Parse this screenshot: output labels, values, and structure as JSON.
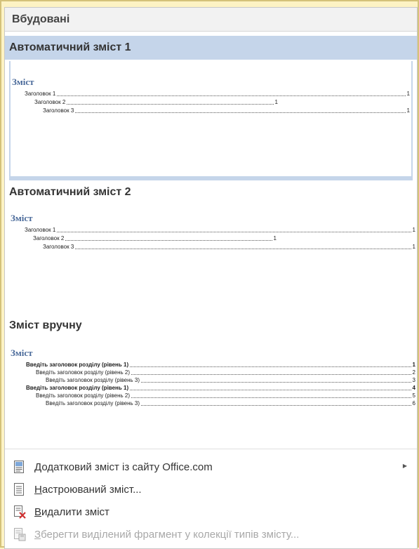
{
  "header": {
    "section_label": "Вбудовані"
  },
  "items": [
    {
      "title": "Автоматичний зміст 1",
      "toc_word": "Зміст",
      "entries": [
        {
          "label": "Заголовок 1",
          "page": "1"
        },
        {
          "label": "Заголовок 2",
          "page": "1"
        },
        {
          "label": "Заголовок 3",
          "page": "1"
        }
      ]
    },
    {
      "title": "Автоматичний зміст 2",
      "toc_word": "Зміст",
      "entries": [
        {
          "label": "Заголовок 1",
          "page": "1"
        },
        {
          "label": "Заголовок 2",
          "page": "1"
        },
        {
          "label": "Заголовок 3",
          "page": "1"
        }
      ]
    },
    {
      "title": "Зміст вручну",
      "toc_word": "Зміст",
      "entries": [
        {
          "label": "Введіть заголовок розділу (рівень 1)",
          "page": "1"
        },
        {
          "label": "Введіть заголовок розділу (рівень 2)",
          "page": "2"
        },
        {
          "label": "Введіть заголовок розділу (рівень 3)",
          "page": "3"
        },
        {
          "label": "Введіть заголовок розділу (рівень 1)",
          "page": "4"
        },
        {
          "label": "Введіть заголовок розділу (рівень 2)",
          "page": "5"
        },
        {
          "label": "Введіть заголовок розділу (рівень 3)",
          "page": "6"
        }
      ]
    }
  ],
  "commands": {
    "more_rest": "одатковий зміст із сайту Office.com",
    "more_key": "Д",
    "custom_rest": "астроюваний зміст...",
    "custom_key": "Н",
    "remove_rest": "идалити зміст",
    "remove_key": "В",
    "save_rest": "берегти виділений фрагмент у колекції типів змісту...",
    "save_key": "З"
  },
  "icons": {
    "more": "document-web-icon",
    "custom": "document-list-icon",
    "remove": "document-delete-icon",
    "save": "document-save-icon"
  },
  "colors": {
    "highlight": "#c5d5ea",
    "toc_heading": "#4a6a9a",
    "delete_x": "#d03030"
  }
}
